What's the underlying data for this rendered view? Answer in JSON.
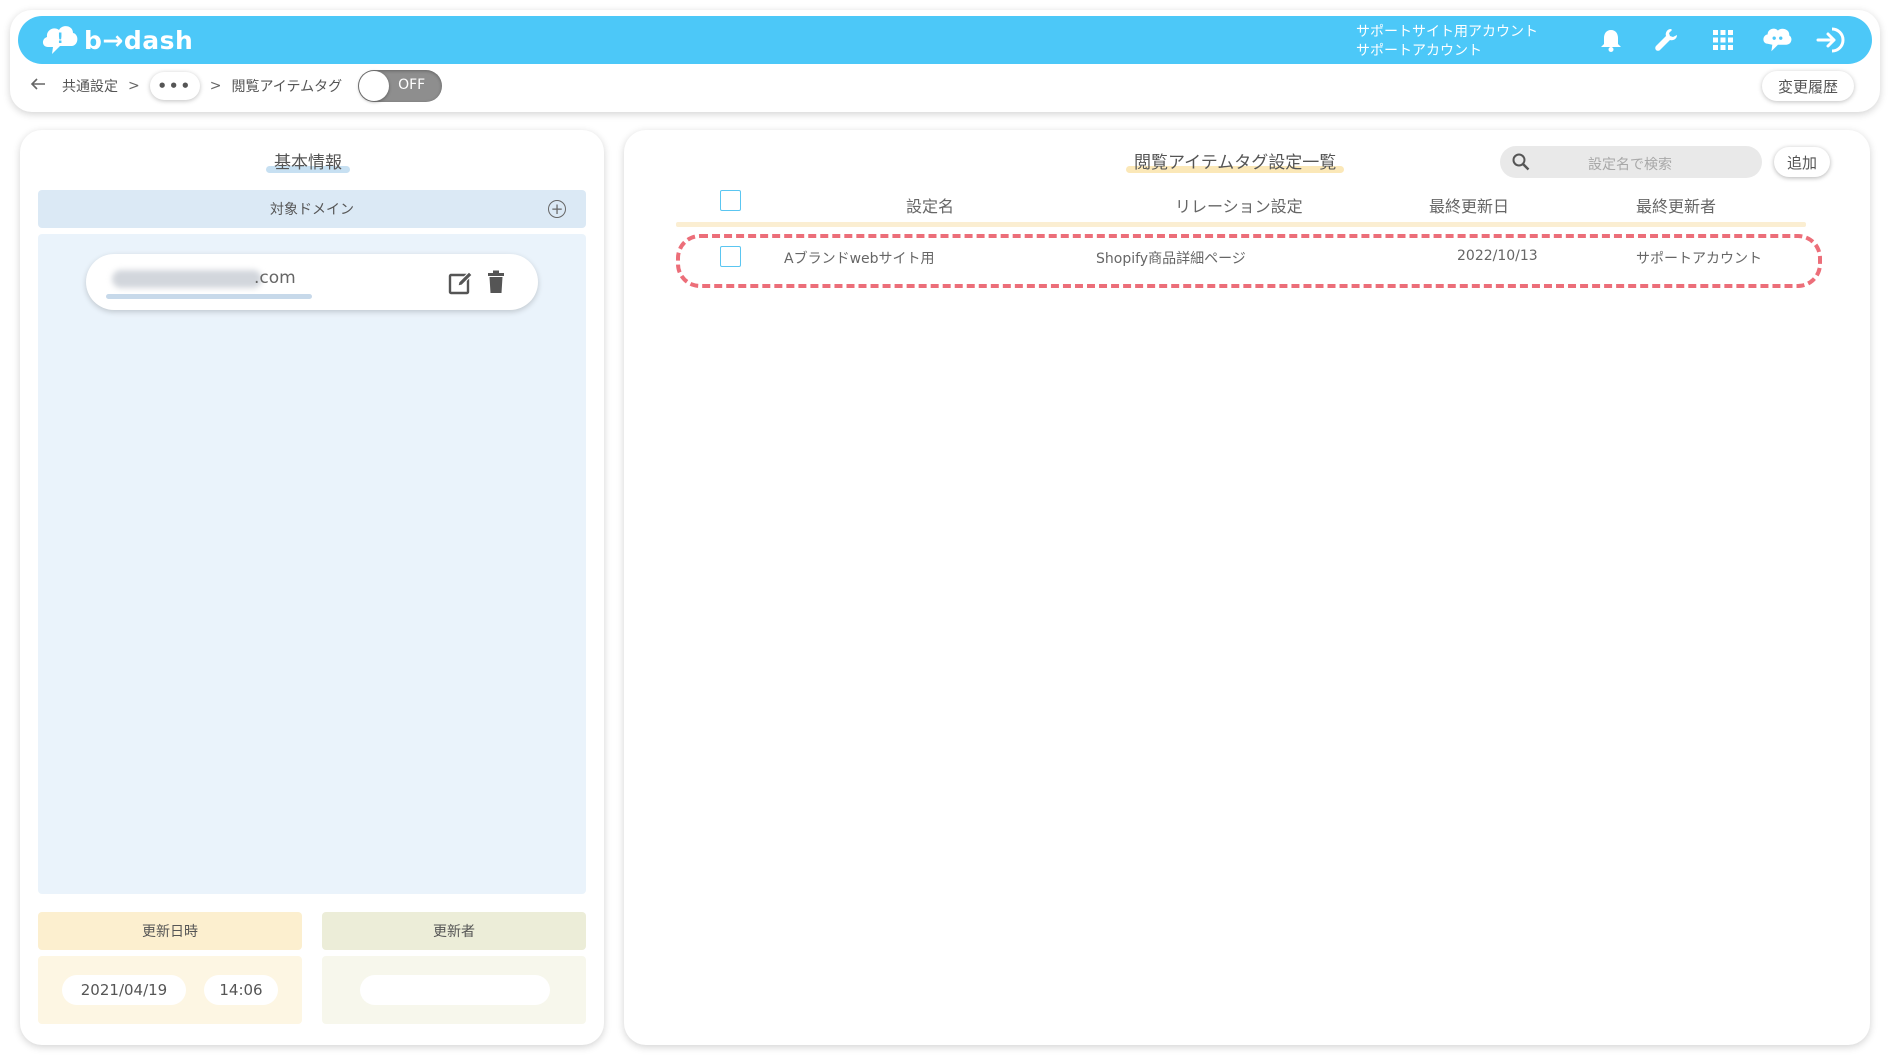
{
  "header": {
    "logo_text": "b→dash",
    "account_line1": "サポートサイト用アカウント",
    "account_line2": "サポートアカウント",
    "icons": [
      "bell-icon",
      "wrench-icon",
      "grid-icon",
      "chat-icon",
      "logout-icon"
    ],
    "bar_color": "#4cc8f8"
  },
  "breadcrumb": {
    "back_icon": "arrow-left-icon",
    "item1": "共通設定",
    "sep": ">",
    "ellipsis": "•••",
    "current": "閲覧アイテムタグ",
    "toggle_label": "OFF",
    "history_label": "変更履歴"
  },
  "left_panel": {
    "title": "基本情報",
    "domain_header": "対象ドメイン",
    "domain_suffix": ".com",
    "updated_at_header": "更新日時",
    "updater_header": "更新者",
    "updated_date": "2021/04/19",
    "updated_time": "14:06"
  },
  "right_panel": {
    "title": "閲覧アイテムタグ設定一覧",
    "search_placeholder": "設定名で検索",
    "add_label": "追加",
    "columns": {
      "name": "設定名",
      "relation": "リレーション設定",
      "updated": "最終更新日",
      "updater": "最終更新者"
    },
    "rows": [
      {
        "name": "Aブランドwebサイト用",
        "relation": "Shopify商品詳細ページ",
        "updated": "2022/10/13",
        "updater": "サポートアカウント"
      }
    ],
    "highlight_color": "#ec6e79"
  }
}
